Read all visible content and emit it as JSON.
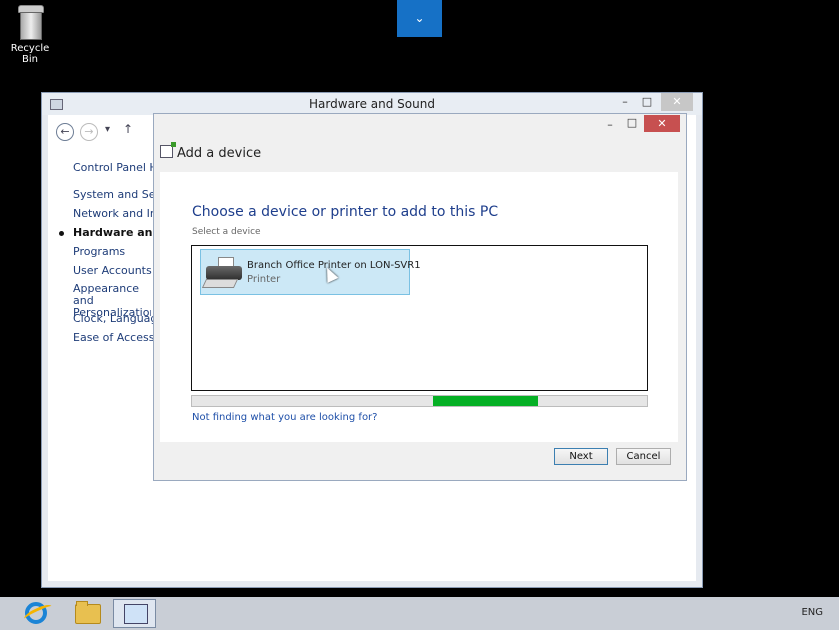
{
  "desktop": {
    "recycle_bin_label": "Recycle Bin",
    "top_tab_icon": "chevron-down-icon"
  },
  "main_window": {
    "title": "Hardware and Sound",
    "nav": {
      "back_icon": "arrow-left-icon",
      "forward_icon": "arrow-right-icon",
      "recent_icon": "chevron-down-icon",
      "up_icon": "arrow-up-icon"
    },
    "sidebar": [
      {
        "label": "Control Panel Home",
        "active": false
      },
      {
        "label": "System and Security",
        "active": false
      },
      {
        "label": "Network and Internet",
        "active": false
      },
      {
        "label": "Hardware and Sound",
        "active": true
      },
      {
        "label": "Programs",
        "active": false
      },
      {
        "label": "User Accounts",
        "active": false
      },
      {
        "label": "Appearance and Personalization",
        "active": false
      },
      {
        "label": "Clock, Language, and Region",
        "active": false
      },
      {
        "label": "Ease of Access",
        "active": false
      }
    ]
  },
  "dialog": {
    "title": "Add a device",
    "heading": "Choose a device or printer to add to this PC",
    "sub": "Select a device",
    "devices": [
      {
        "name": "Branch Office Printer on LON-SVR1",
        "type": "Printer",
        "icon": "printer-icon",
        "selected": true
      }
    ],
    "progress": {
      "start": 0.53,
      "end": 0.76
    },
    "not_finding": "Not finding what you are looking for?",
    "next": "Next",
    "cancel": "Cancel"
  },
  "taskbar": {
    "items": [
      "internet-explorer-icon",
      "file-explorer-icon",
      "control-panel-icon"
    ],
    "language": "ENG"
  },
  "colors": {
    "accent": "#1671c6",
    "progress": "#06b025",
    "close": "#c75050"
  }
}
